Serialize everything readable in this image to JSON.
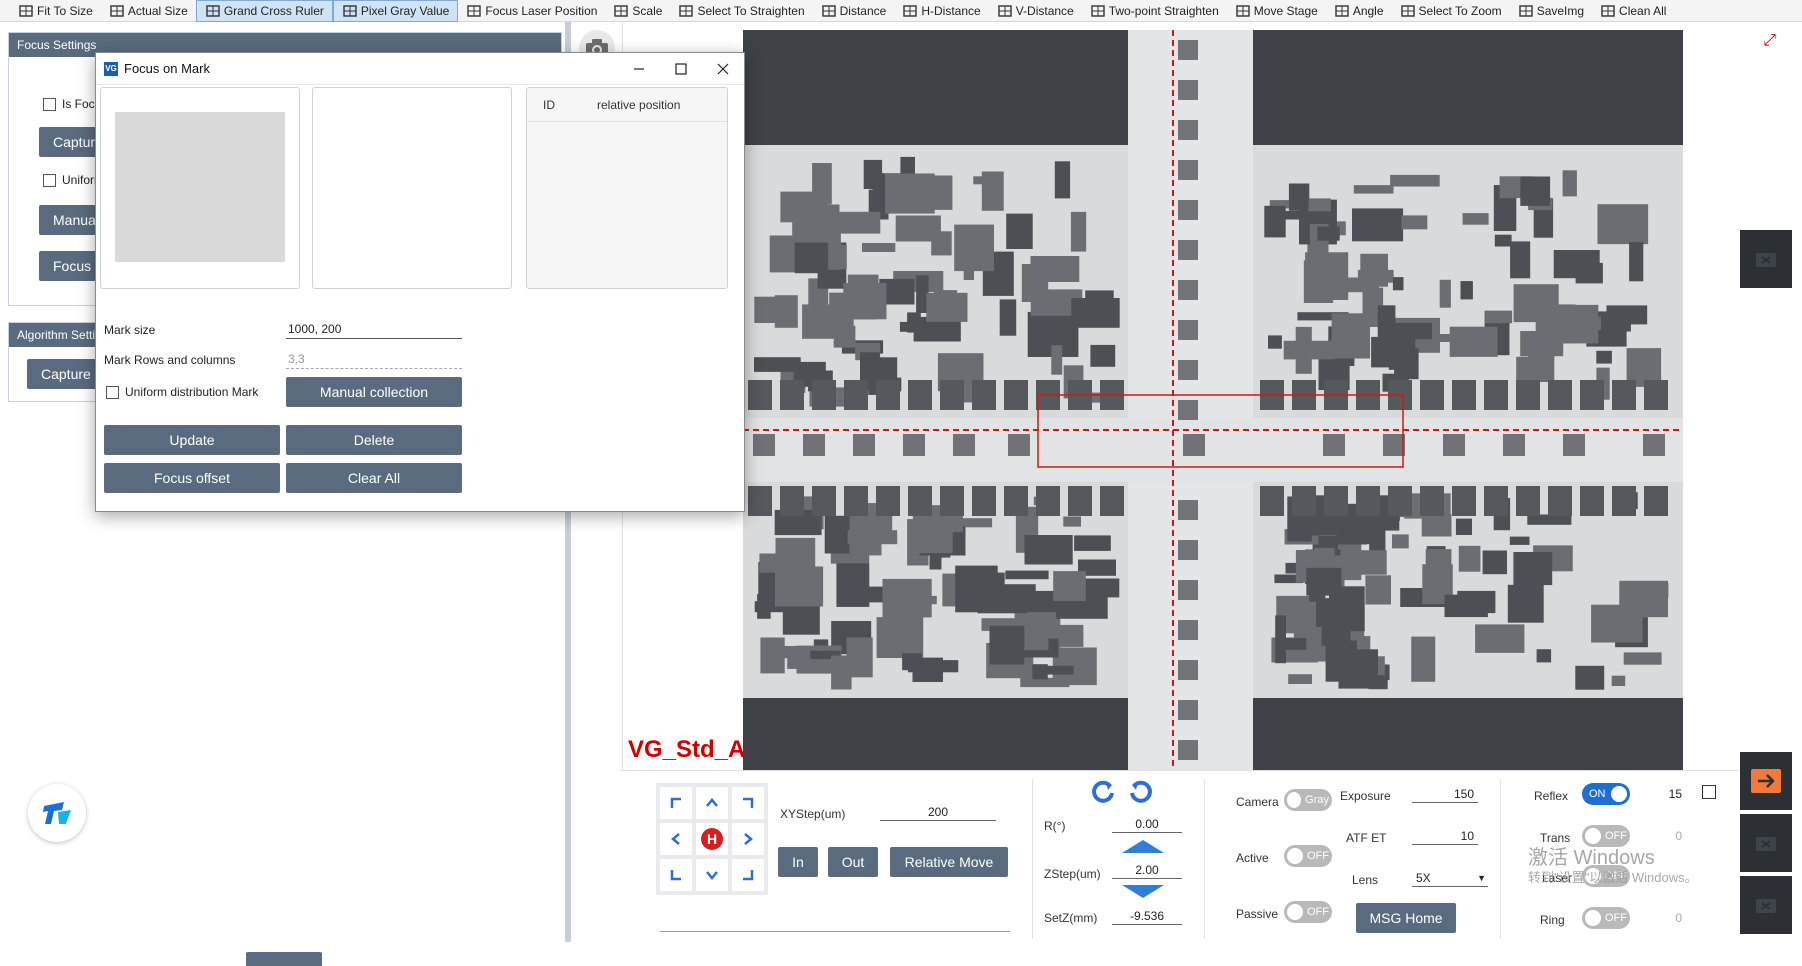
{
  "toolbar": {
    "items": [
      {
        "label": "Fit To Size",
        "icon": "fit-size-icon"
      },
      {
        "label": "Actual Size",
        "icon": "actual-size-icon"
      },
      {
        "label": "Grand Cross Ruler",
        "icon": "cross-ruler-icon",
        "active": true
      },
      {
        "label": "Pixel Gray Value",
        "icon": "pixel-gray-icon",
        "active": true
      },
      {
        "label": "Focus Laser Position",
        "icon": "laser-icon"
      },
      {
        "label": "Scale",
        "icon": "scale-icon"
      },
      {
        "label": "Select To Straighten",
        "icon": "straighten-icon"
      },
      {
        "label": "Distance",
        "icon": "ruler-icon"
      },
      {
        "label": "H-Distance",
        "icon": "h-distance-icon"
      },
      {
        "label": "V-Distance",
        "icon": "v-distance-icon"
      },
      {
        "label": "Two-point Straighten",
        "icon": "two-point-icon"
      },
      {
        "label": "Move Stage",
        "icon": "hand-icon"
      },
      {
        "label": "Angle",
        "icon": "angle-icon"
      },
      {
        "label": "Select To Zoom",
        "icon": "zoom-select-icon"
      },
      {
        "label": "SaveImg",
        "icon": "save-image-icon"
      },
      {
        "label": "Clean All",
        "icon": "clean-icon"
      }
    ]
  },
  "left_panel": {
    "focus_settings": {
      "header": "Focus Settings",
      "is_focus_label": "Is Focus",
      "capture_label": "Capture",
      "uniform_label": "Uniform",
      "manual_label": "Manuall",
      "focus_t_label": "Focus T"
    },
    "algorithm_settings": {
      "header": "Algorithm Setti",
      "capture_label": "Capture"
    }
  },
  "image": {
    "label": "VG_Std_A"
  },
  "dialog": {
    "title": "Focus on Mark",
    "table_headers": [
      "ID",
      "relative position"
    ],
    "mark_size_label": "Mark size",
    "mark_size_value": "1000, 200",
    "mark_rows_label": "Mark Rows and columns",
    "mark_rows_value": "3,3",
    "uniform_label": "Uniform distribution Mark",
    "manual_collection_label": "Manual collection",
    "update_label": "Update",
    "delete_label": "Delete",
    "focus_offset_label": "Focus offset",
    "clear_all_label": "Clear All"
  },
  "controls": {
    "xystep_label": "XYStep(um)",
    "xystep_value": "200",
    "in_label": "In",
    "out_label": "Out",
    "relative_move_label": "Relative Move",
    "home_label": "H",
    "r_label": "R(°)",
    "r_value": "0.00",
    "zstep_label": "ZStep(um)",
    "zstep_value": "2.00",
    "setz_label": "SetZ(mm)",
    "setz_value": "-9.536",
    "camera_label": "Camera",
    "camera_toggle": "Gray",
    "active_label": "Active",
    "active_toggle": "OFF",
    "passive_label": "Passive",
    "passive_toggle": "OFF",
    "exposure_label": "Exposure",
    "exposure_value": "150",
    "atf_label": "ATF ET",
    "atf_value": "10",
    "lens_label": "Lens",
    "lens_value": "5X",
    "msg_home_label": "MSG Home",
    "reflex_label": "Reflex",
    "reflex_toggle": "ON",
    "reflex_value": "15",
    "trans_label": "Trans",
    "trans_toggle": "OFF",
    "trans_value": "0",
    "laser_label": "Laser",
    "laser_toggle": "OFF",
    "ring_label": "Ring",
    "ring_toggle": "OFF",
    "ring_value": "0"
  },
  "watermark": {
    "line1": "激活 Windows",
    "line2": "转到\"设置\"以激活 Windows。"
  },
  "colors": {
    "button": "#5a6b7f",
    "crosshair": "#d01818",
    "label_red": "#cc0000",
    "toggle_on": "#1e6fd0"
  }
}
